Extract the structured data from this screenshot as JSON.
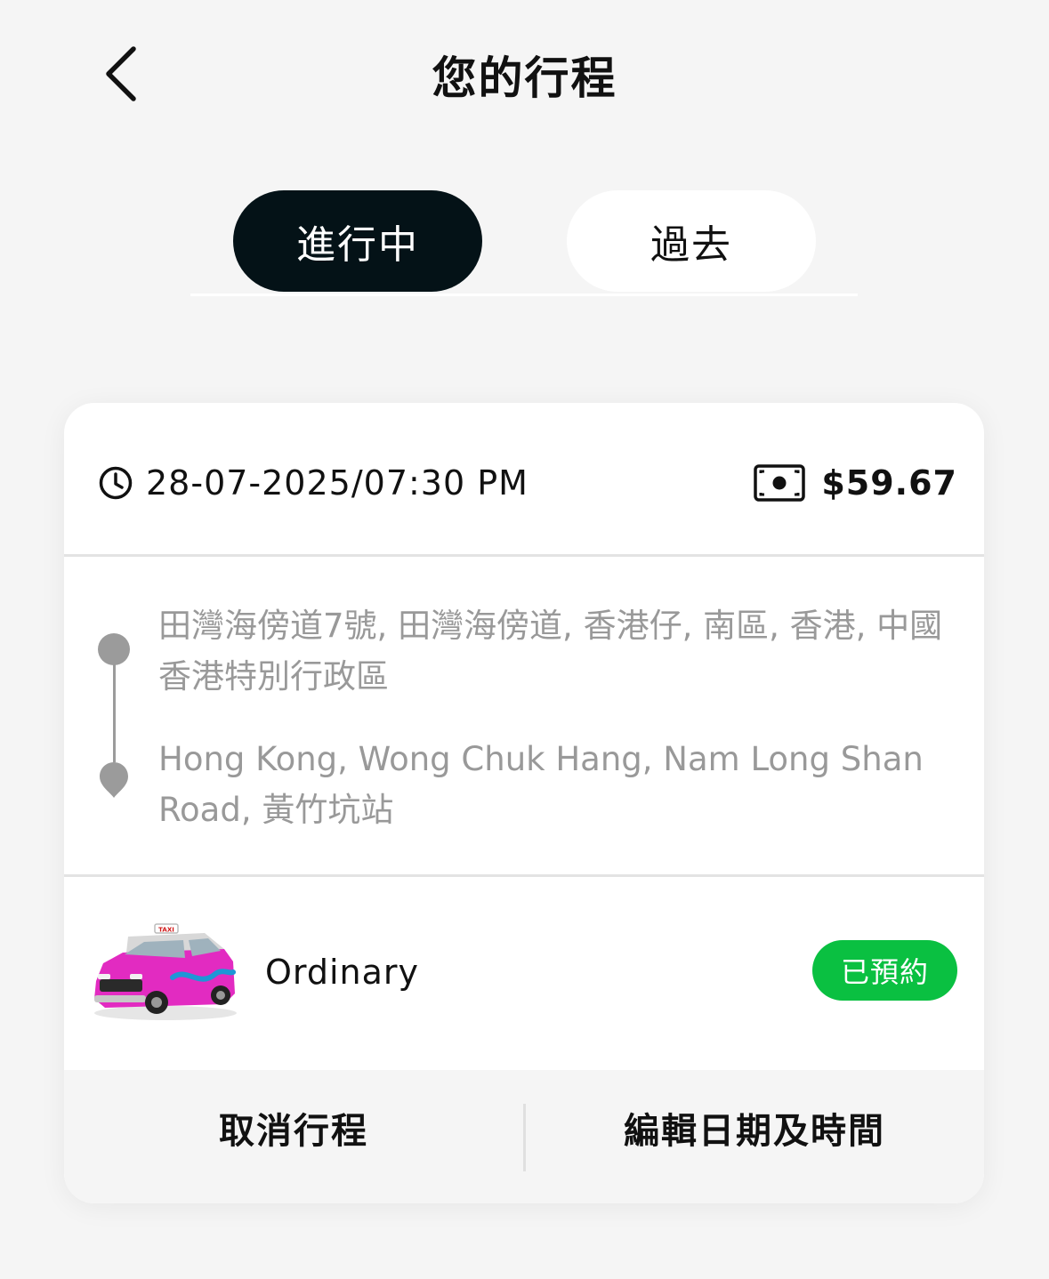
{
  "header": {
    "title": "您的行程",
    "back_icon": "chevron-left-icon"
  },
  "tabs": [
    {
      "label": "進行中",
      "active": true
    },
    {
      "label": "過去",
      "active": false
    }
  ],
  "trip": {
    "datetime": "28-07-2025/07:30 PM",
    "clock_icon": "clock-icon",
    "fare": "$59.67",
    "fare_icon": "cash-icon",
    "pickup": "田灣海傍道7號, 田灣海傍道, 香港仔, 南區, 香港, 中國香港特別行政區",
    "dropoff": "Hong Kong, Wong Chuk Hang, Nam Long Shan Road, 黃竹坑站",
    "vehicle_type": "Ordinary",
    "taxi_sign_text": "TAXI",
    "status": "已預約",
    "status_color": "#0ac041"
  },
  "actions": {
    "cancel_label": "取消行程",
    "edit_label": "編輯日期及時間"
  },
  "colors": {
    "active_tab": "#041217",
    "taxi_body": "#e22bc1",
    "background": "#f5f5f5"
  }
}
